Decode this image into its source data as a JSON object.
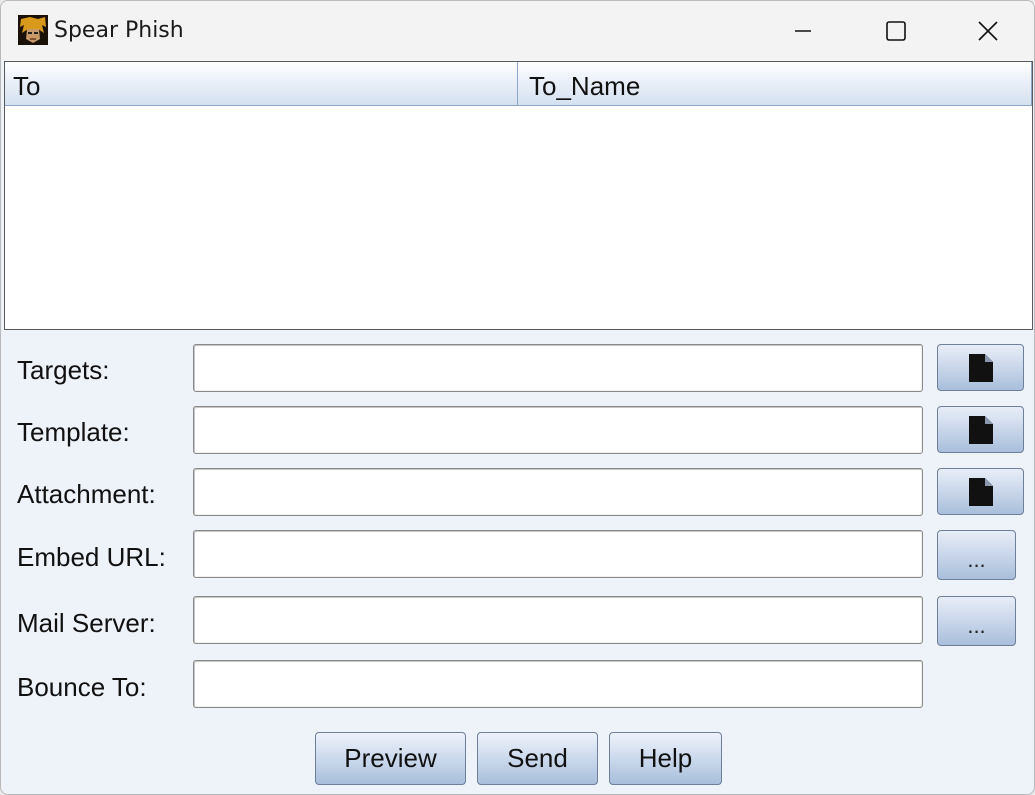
{
  "window": {
    "title": "Spear Phish"
  },
  "table": {
    "columns": [
      "To",
      "To_Name"
    ],
    "rows": []
  },
  "form": {
    "targets": {
      "label": "Targets:",
      "value": ""
    },
    "template": {
      "label": "Template:",
      "value": ""
    },
    "attachment": {
      "label": "Attachment:",
      "value": ""
    },
    "embed_url": {
      "label": "Embed URL:",
      "value": "",
      "button": "..."
    },
    "mail_server": {
      "label": "Mail Server:",
      "value": "",
      "button": "..."
    },
    "bounce_to": {
      "label": "Bounce To:",
      "value": ""
    }
  },
  "actions": {
    "preview": "Preview",
    "send": "Send",
    "help": "Help"
  },
  "icons": {
    "file": "file-icon",
    "minimize": "minimize-icon",
    "maximize": "maximize-icon",
    "close": "close-icon"
  },
  "colors": {
    "header_gradient_bottom": "#d5e1f0",
    "panel_bg": "#eef2f9",
    "button_gradient_bottom": "#a8bedb"
  }
}
